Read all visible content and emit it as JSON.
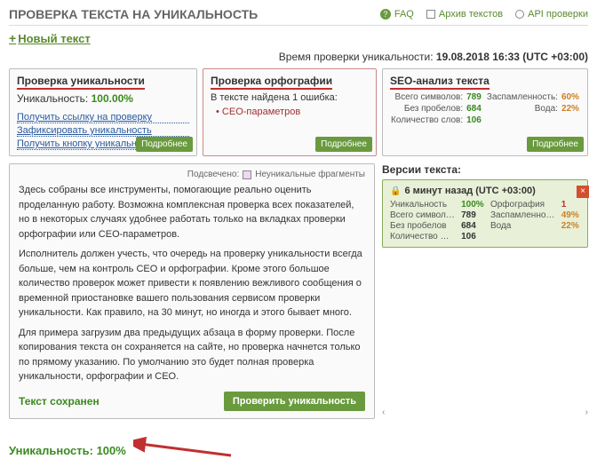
{
  "header": {
    "title": "ПРОВЕРКА ТЕКСТА НА УНИКАЛЬНОСТЬ",
    "faq": "FAQ",
    "archive": "Архив текстов",
    "api": "API проверки",
    "new_text": "Новый текст"
  },
  "time": {
    "label": "Время проверки уникальности:",
    "value": "19.08.2018 16:33 (UTC +03:00)"
  },
  "card_uniq": {
    "title": "Проверка уникальности",
    "label": "Уникальность:",
    "value": "100.00%",
    "links": [
      "Получить ссылку на проверку",
      "Зафиксировать уникальность",
      "Получить кнопку уникальности"
    ],
    "more": "Подробнее"
  },
  "card_spell": {
    "title": "Проверка орфографии",
    "found": "В тексте найдена 1 ошибка:",
    "item": "CEO-параметров",
    "more": "Подробнее"
  },
  "card_seo": {
    "title": "SEO-анализ текста",
    "rows": [
      {
        "l1": "Всего символов:",
        "v1": "789",
        "l2": "Заспамленность:",
        "v2": "60%",
        "c2": "o"
      },
      {
        "l1": "Без пробелов:",
        "v1": "684",
        "l2": "Вода:",
        "v2": "22%",
        "c2": "o"
      },
      {
        "l1": "Количество слов:",
        "v1": "106",
        "l2": "",
        "v2": "",
        "c2": ""
      }
    ],
    "more": "Подробнее"
  },
  "highlight": {
    "label": "Подсвечено:",
    "legend": "Неуникальные фрагменты"
  },
  "article": {
    "p1": "Здесь собраны все инструменты, помогающие реально оценить проделанную работу. Возможна комплексная проверка всех показателей, но в некоторых случаях удобнее работать только на вкладках проверки орфографии или CEO-параметров.",
    "p2": "Исполнитель должен учесть, что очередь на проверку уникальности всегда больше, чем на контроль CEO и орфографии. Кроме этого большое количество проверок может привести к появлению вежливого сообщения о временной приостановке вашего пользования сервисом проверки уникальности. Как правило, на 30 минут, но иногда и этого бывает много.",
    "p3": "Для примера загрузим два предыдущих абзаца в форму проверки. После копирования текста он сохраняется на сайте, но проверка начнется только по прямому указанию. По умолчанию это будет полная проверка уникальности, орфографии и CEO."
  },
  "saved": "Текст сохранен",
  "check_btn": "Проверить уникальность",
  "versions": {
    "title": "Версии текста:",
    "hdr": "6 минут назад  (UTC +03:00)",
    "rows": [
      {
        "l1": "Уникальность",
        "v1": "100%",
        "c1": "g",
        "l2": "Орфография",
        "v2": "1",
        "c2": "r"
      },
      {
        "l1": "Всего символ…",
        "v1": "789",
        "c1": "",
        "l2": "Заспамленно…",
        "v2": "49%",
        "c2": "o"
      },
      {
        "l1": "Без пробелов",
        "v1": "684",
        "c1": "",
        "l2": "Вода",
        "v2": "22%",
        "c2": "o"
      },
      {
        "l1": "Количество …",
        "v1": "106",
        "c1": "",
        "l2": "",
        "v2": "",
        "c2": ""
      }
    ],
    "prev": "‹",
    "next": "›"
  },
  "footer": {
    "label": "Уникальность: 100%"
  }
}
